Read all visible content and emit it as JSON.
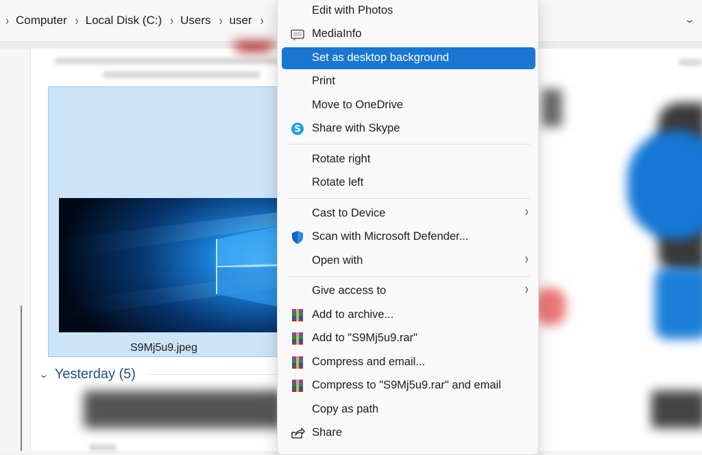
{
  "breadcrumb": {
    "items": [
      "Computer",
      "Local Disk (C:)",
      "Users",
      "user"
    ]
  },
  "file": {
    "name": "S9Mj5u9.jpeg"
  },
  "group": {
    "label": "Yesterday (5)"
  },
  "menu": {
    "items": [
      {
        "label": "Edit with Photos",
        "icon": "",
        "submenu": false
      },
      {
        "label": "MediaInfo",
        "icon": "mediainfo-icon",
        "submenu": false
      },
      {
        "label": "Set as desktop background",
        "icon": "",
        "submenu": false,
        "highlighted": true
      },
      {
        "label": "Print",
        "icon": "",
        "submenu": false
      },
      {
        "label": "Move to OneDrive",
        "icon": "",
        "submenu": false
      },
      {
        "label": "Share with Skype",
        "icon": "skype-icon",
        "submenu": false
      },
      {
        "label": "Rotate right",
        "icon": "",
        "submenu": false
      },
      {
        "label": "Rotate left",
        "icon": "",
        "submenu": false
      },
      {
        "label": "Cast to Device",
        "icon": "",
        "submenu": true
      },
      {
        "label": "Scan with Microsoft Defender...",
        "icon": "defender-shield-icon",
        "submenu": false
      },
      {
        "label": "Open with",
        "icon": "",
        "submenu": true
      },
      {
        "label": "Give access to",
        "icon": "",
        "submenu": true
      },
      {
        "label": "Add to archive...",
        "icon": "winrar-icon",
        "submenu": false
      },
      {
        "label": "Add to \"S9Mj5u9.rar\"",
        "icon": "winrar-icon",
        "submenu": false
      },
      {
        "label": "Compress and email...",
        "icon": "winrar-icon",
        "submenu": false
      },
      {
        "label": "Compress to \"S9Mj5u9.rar\" and email",
        "icon": "winrar-icon",
        "submenu": false
      },
      {
        "label": "Copy as path",
        "icon": "",
        "submenu": false
      },
      {
        "label": "Share",
        "icon": "share-icon",
        "submenu": false
      }
    ]
  },
  "colors": {
    "highlight": "#1976d2",
    "selection": "#cce4f7",
    "group_text": "#1f4f8a"
  }
}
